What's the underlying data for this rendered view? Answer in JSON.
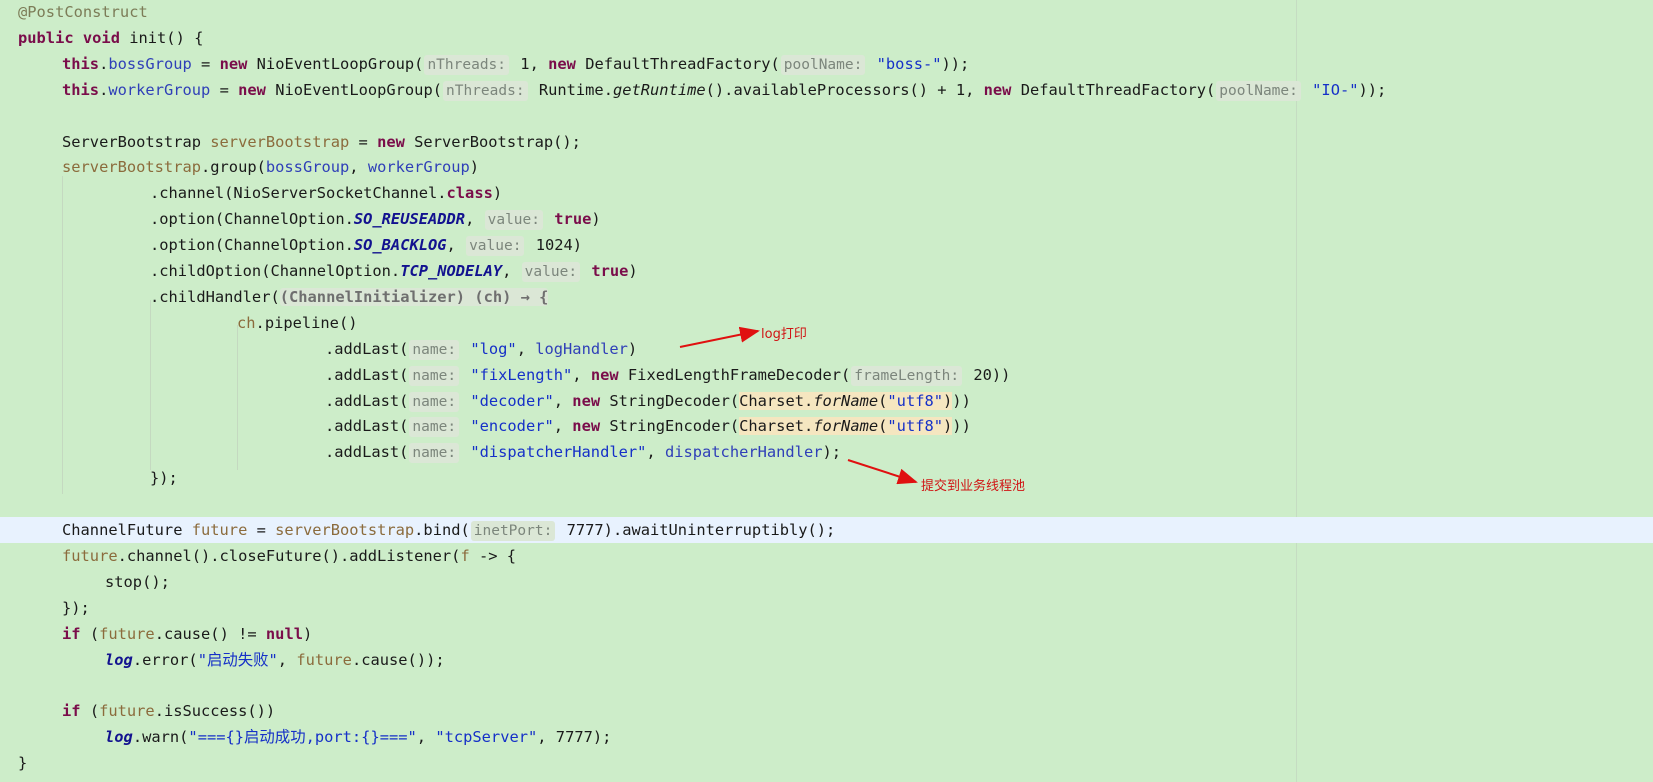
{
  "editor": {
    "lines": [
      "@PostConstruct",
      "public void init() {",
      "this.bossGroup = new NioEventLoopGroup(nThreads: 1, new DefaultThreadFactory(poolName: \"boss-\"));",
      "this.workerGroup = new NioEventLoopGroup(nThreads: Runtime.getRuntime().availableProcessors() + 1, new DefaultThreadFactory(poolName: \"IO-\"));",
      "",
      "ServerBootstrap serverBootstrap = new ServerBootstrap();",
      "serverBootstrap.group(bossGroup, workerGroup)",
      ".channel(NioServerSocketChannel.class)",
      ".option(ChannelOption.SO_REUSEADDR, value: true)",
      ".option(ChannelOption.SO_BACKLOG, value: 1024)",
      ".childOption(ChannelOption.TCP_NODELAY, value: true)",
      ".childHandler((ChannelInitializer) (ch) → {",
      "ch.pipeline()",
      ".addLast(name: \"log\", logHandler)",
      ".addLast(name: \"fixLength\", new FixedLengthFrameDecoder(frameLength: 20))",
      ".addLast(name: \"decoder\", new StringDecoder(Charset.forName(\"utf8\")))",
      ".addLast(name: \"encoder\", new StringEncoder(Charset.forName(\"utf8\")))",
      ".addLast(name: \"dispatcherHandler\", dispatcherHandler);",
      "});",
      "",
      "ChannelFuture future = serverBootstrap.bind(inetPort: 7777).awaitUninterruptibly();",
      "future.channel().closeFuture().addListener(f -> {",
      "stop();",
      "});",
      "if (future.cause() != null)",
      "log.error(\"启动失败\", future.cause());",
      "",
      "if (future.isSuccess())",
      "log.warn(\"==={}启动成功,port:{}===\", \"tcpServer\", 7777);",
      "}"
    ],
    "current_line": 21
  },
  "annotations": {
    "log_note": "log打印",
    "dispatch_note": "提交到业务线程池"
  },
  "colors": {
    "background": "#cdedc9",
    "current_line": "#e8f2fe",
    "keyword": "#7a0d4a",
    "string": "#1530c8",
    "field": "#2f3fb8",
    "arrow": "#e01010"
  }
}
